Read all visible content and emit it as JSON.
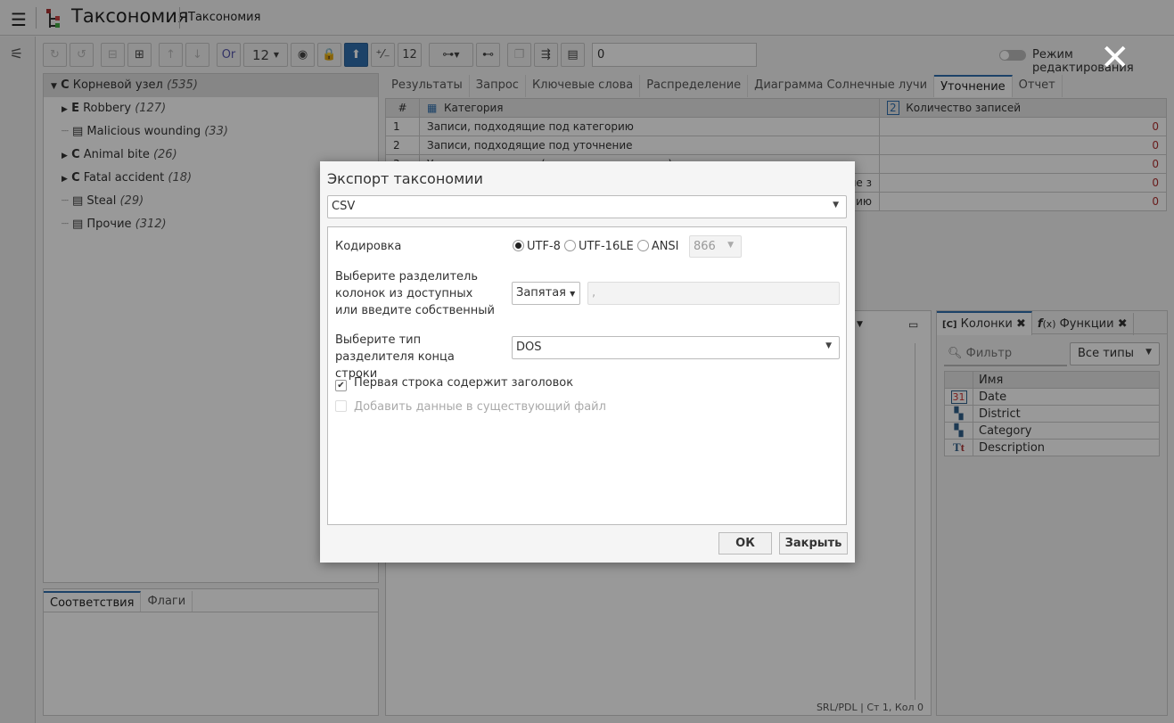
{
  "app": {
    "title": "Таксономия",
    "subtitle": "Таксономия"
  },
  "toolbar": {
    "font_size": "12",
    "counter_value": "0",
    "or_label": "Or",
    "edit_mode_label": "Режим редактирования"
  },
  "tree": {
    "root": {
      "type": "C",
      "label": "Корневой узел",
      "count": "(535)"
    },
    "items": [
      {
        "type": "E",
        "label": "Robbery",
        "count": "(127)",
        "expandable": true
      },
      {
        "type": "doc",
        "label": "Malicious wounding",
        "count": "(33)",
        "expandable": false
      },
      {
        "type": "C",
        "label": "Animal bite",
        "count": "(26)",
        "expandable": true
      },
      {
        "type": "C",
        "label": "Fatal accident",
        "count": "(18)",
        "expandable": true
      },
      {
        "type": "doc",
        "label": "Steal",
        "count": "(29)",
        "expandable": false
      },
      {
        "type": "doc",
        "label": "Прочие",
        "count": "(312)",
        "expandable": false
      }
    ]
  },
  "bottom_left": {
    "tabs": [
      "Соответствия",
      "Флаги"
    ]
  },
  "main_tabs": [
    "Результаты",
    "Запрос",
    "Ключевые слова",
    "Распределение",
    "Диаграмма Солнечные лучи",
    "Уточнение",
    "Отчет"
  ],
  "active_tab": "Уточнение",
  "grid": {
    "headers": [
      "#",
      "Категория",
      "Количество записей"
    ],
    "rows": [
      [
        "1",
        "Записи, подходящие под категорию",
        "0"
      ],
      [
        "2",
        "Записи, подходящие под уточнение",
        "0"
      ],
      [
        "3",
        "Уточненные записи (категория и точность)",
        "0"
      ],
      [
        "4",
        "щие з",
        "0"
      ],
      [
        "5",
        "нию",
        "0"
      ]
    ]
  },
  "status": "SRL/PDL | Ст 1, Кол 0",
  "columns_panel": {
    "tabs": [
      "Колонки",
      "Функции"
    ],
    "filter_placeholder": "Фильтр",
    "type_select": "Все типы",
    "header": "Имя",
    "rows": [
      {
        "icon": "calendar-icon",
        "name": "Date"
      },
      {
        "icon": "category-icon",
        "name": "District"
      },
      {
        "icon": "category-icon",
        "name": "Category"
      },
      {
        "icon": "text-icon",
        "name": "Description"
      }
    ]
  },
  "dialog": {
    "title": "Экспорт таксономии",
    "format": "CSV",
    "encoding_label": "Кодировка",
    "encodings": [
      "UTF-8",
      "UTF-16LE",
      "ANSI"
    ],
    "encoding_selected": "UTF-8",
    "codepage": "866",
    "delimiter_label": "Выберите разделитель колонок из доступных или введите собственный",
    "delimiter": "Запятая",
    "delimiter_value": ",",
    "eol_label": "Выберите тип разделителя конца строки",
    "eol": "DOS",
    "header_checkbox": "Первая строка содержит заголовок",
    "header_checked": true,
    "append_checkbox": "Добавить данные в существующий файл",
    "append_checked": false,
    "ok": "ОК",
    "close": "Закрыть"
  },
  "colors": {
    "accent": "#2f6fae",
    "count_red": "#b03030"
  }
}
